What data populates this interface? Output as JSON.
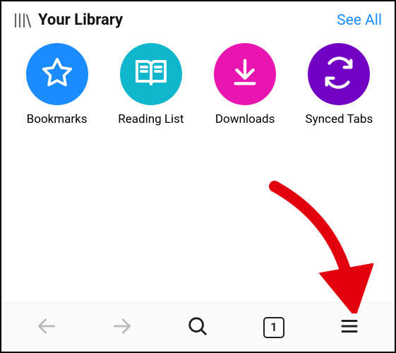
{
  "header": {
    "title": "Your Library",
    "see_all": "See All"
  },
  "tiles": [
    {
      "id": "bookmarks",
      "label": "Bookmarks",
      "icon": "star-icon",
      "colorClass": "c-blue"
    },
    {
      "id": "readinglist",
      "label": "Reading List",
      "icon": "book-icon",
      "colorClass": "c-teal"
    },
    {
      "id": "downloads",
      "label": "Downloads",
      "icon": "download-icon",
      "colorClass": "c-magenta"
    },
    {
      "id": "syncedtabs",
      "label": "Synced Tabs",
      "icon": "sync-icon",
      "colorClass": "c-purple"
    }
  ],
  "toolbar": {
    "back_enabled": false,
    "forward_enabled": false,
    "tab_count": "1"
  }
}
